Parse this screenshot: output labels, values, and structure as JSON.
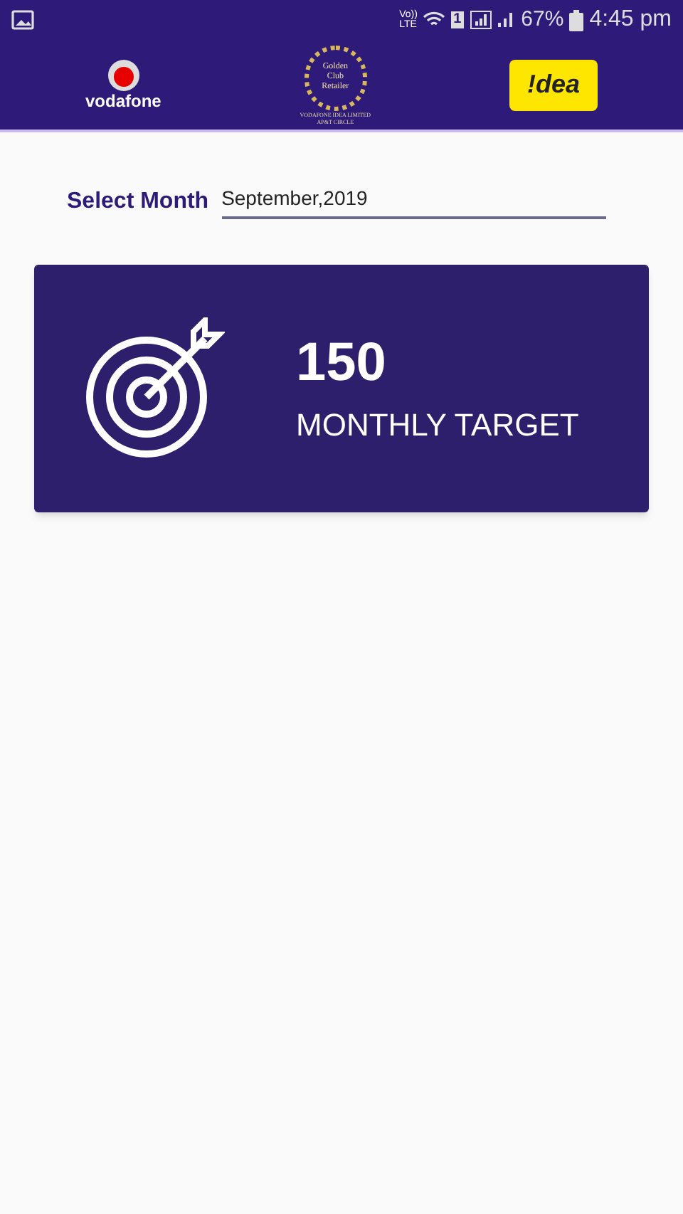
{
  "status_bar": {
    "network": "Vo)) LTE",
    "sim": "1",
    "battery": "67%",
    "time": "4:45 pm"
  },
  "header": {
    "left_logo": "vodafone",
    "crest": [
      "Golden",
      "Club",
      "Retailer"
    ],
    "crest_caption": [
      "VODAFONE IDEA LIMITED",
      "AP&T CIRCLE"
    ],
    "right_logo": "!dea"
  },
  "month": {
    "label": "Select Month",
    "value": "September,2019"
  },
  "target_card": {
    "value": "150",
    "label": "MONTHLY TARGET"
  }
}
